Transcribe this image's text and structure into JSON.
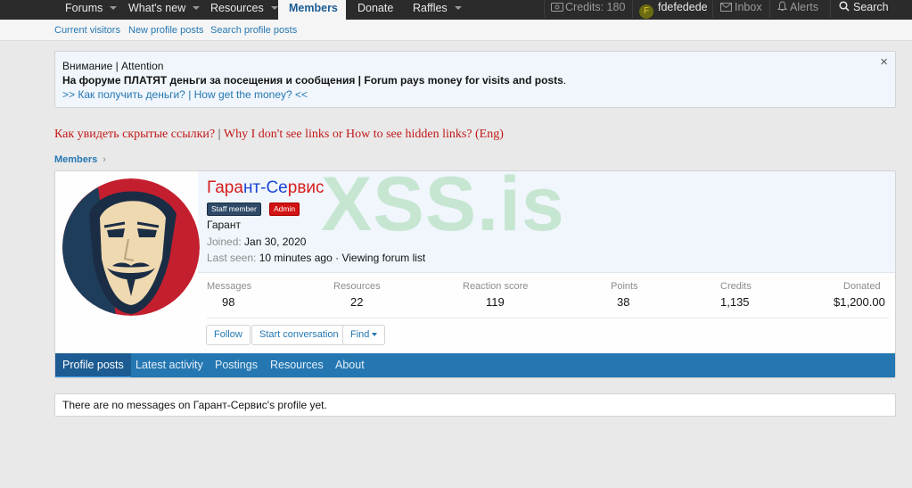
{
  "topnav": {
    "items": [
      {
        "label": "Forums",
        "dropdown": true
      },
      {
        "label": "What's new",
        "dropdown": true
      },
      {
        "label": "Resources",
        "dropdown": true
      },
      {
        "label": "Members",
        "dropdown": false,
        "active": true
      },
      {
        "label": "Donate",
        "dropdown": false
      },
      {
        "label": "Raffles",
        "dropdown": true
      }
    ],
    "credits": "Credits: 180",
    "user_initial": "F",
    "username": "fdefedede",
    "inbox": "Inbox",
    "alerts": "Alerts",
    "search": "Search"
  },
  "subnav": [
    "Current visitors",
    "New profile posts",
    "Search profile posts"
  ],
  "notice": {
    "line1": "Внимание | Attention",
    "line2": "На форуме ПЛАТЯТ деньги за посещения и сообщения | Forum pays money for visits and posts",
    "line2_end": ".",
    "line3": ">> Как получить деньги? | How get the money? <<",
    "close": "×"
  },
  "hidden_links": {
    "ru": "Как увидеть скрытые ссылки?",
    "sep": "|",
    "en": "Why I don't see links or How to see hidden links? (Eng)"
  },
  "breadcrumb": "Members",
  "watermark": "XSS.is",
  "profile": {
    "name_part1": "Гара",
    "name_part2": "нт-Се",
    "name_part3": "рвис",
    "badges": [
      "Staff member",
      "Admin"
    ],
    "title": "Гарант",
    "joined_label": "Joined:",
    "joined": "Jan 30, 2020",
    "last_seen_label": "Last seen:",
    "last_seen": "10 minutes ago · Viewing forum list",
    "stats": [
      {
        "label": "Messages",
        "value": "98"
      },
      {
        "label": "Resources",
        "value": "22"
      },
      {
        "label": "Reaction score",
        "value": "119"
      },
      {
        "label": "Points",
        "value": "38"
      },
      {
        "label": "Credits",
        "value": "1,135"
      },
      {
        "label": "Donated",
        "value": "$1,200.00"
      }
    ],
    "buttons": {
      "follow": "Follow",
      "start_conversation": "Start conversation",
      "find": "Find"
    },
    "tabs": [
      "Profile posts",
      "Latest activity",
      "Postings",
      "Resources",
      "About"
    ]
  },
  "empty_message": "There are no messages on Гарант-Сервис's profile yet.",
  "colors": {
    "nav_bg": "#2b2b2b",
    "accent": "#2577b1",
    "tab_active": "#1c5c93",
    "link_red": "#c31818"
  }
}
